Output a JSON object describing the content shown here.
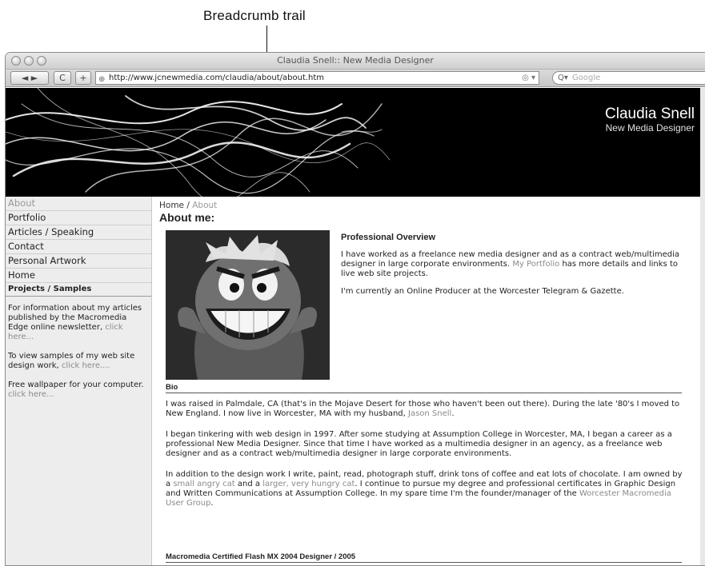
{
  "callout": {
    "label": "Breadcrumb trail"
  },
  "browser": {
    "window_title": "Claudia Snell:: New Media Designer",
    "url": "http://www.jcnewmedia.com/claudia/about/about.htm",
    "search_placeholder": "Google",
    "back_label": "◄ ►",
    "reload_label": "C",
    "add_label": "+"
  },
  "header": {
    "name": "Claudia Snell",
    "tagline": "New Media Designer"
  },
  "sidebar": {
    "items": [
      {
        "label": "About"
      },
      {
        "label": "Portfolio"
      },
      {
        "label": "Articles / Speaking"
      },
      {
        "label": "Contact"
      },
      {
        "label": "Personal Artwork"
      },
      {
        "label": "Home"
      }
    ],
    "section_title": "Projects / Samples",
    "blurbs": [
      {
        "text": "For information about my articles published by the Macromedia Edge online newsletter,",
        "link": "click here..."
      },
      {
        "text": "To view samples of my web site design work,",
        "link": "click here...."
      },
      {
        "text": "Free wallpaper for your computer.",
        "link": "click here..."
      }
    ]
  },
  "main": {
    "breadcrumb_home": "Home",
    "breadcrumb_sep": " / ",
    "breadcrumb_current": "About",
    "heading": "About me:",
    "overview_title": "Professional Overview",
    "overview_p1_pre": "I have worked as a freelance new media designer and as a contract web/multimedia designer in large corporate environments.",
    "overview_p1_link": "My Portfolio",
    "overview_p1_post": "has more details and links to live web site projects.",
    "overview_p2": "I'm currently an Online Producer at the Worcester Telegram & Gazette.",
    "bio_title": "Bio",
    "bio_p1_pre": "I was raised in Palmdale, CA (that's in the Mojave Desert for those who haven't been out there). During the late '80's I moved to New England. I now live in Worcester, MA with my husband,",
    "bio_p1_link": "Jason Snell",
    "bio_p1_post": ".",
    "bio_p2": "I began tinkering with web design in 1997. After some studying at Assumption College in Worcester, MA, I began a career as a professional New Media Designer. Since that time I have worked as a multimedia designer in an agency, as a freelance web designer and as a contract web/multimedia designer in large corporate environments.",
    "bio_p3_a": "In addition to the design work I write, paint, read, photograph stuff, drink tons of coffee and eat lots of chocolate. I am owned by a",
    "bio_p3_link1": "small angry cat",
    "bio_p3_b": "and a",
    "bio_p3_link2": "larger, very hungry cat",
    "bio_p3_c": ". I continue to pursue my degree and professional certificates in Graphic Design and Written Communications at Assumption College. In my spare time I'm the founder/manager of the",
    "bio_p3_link3": "Worcester Macromedia User Group",
    "bio_p3_d": ".",
    "cert_title": "Macromedia Certified Flash MX 2004 Designer / 2005"
  }
}
